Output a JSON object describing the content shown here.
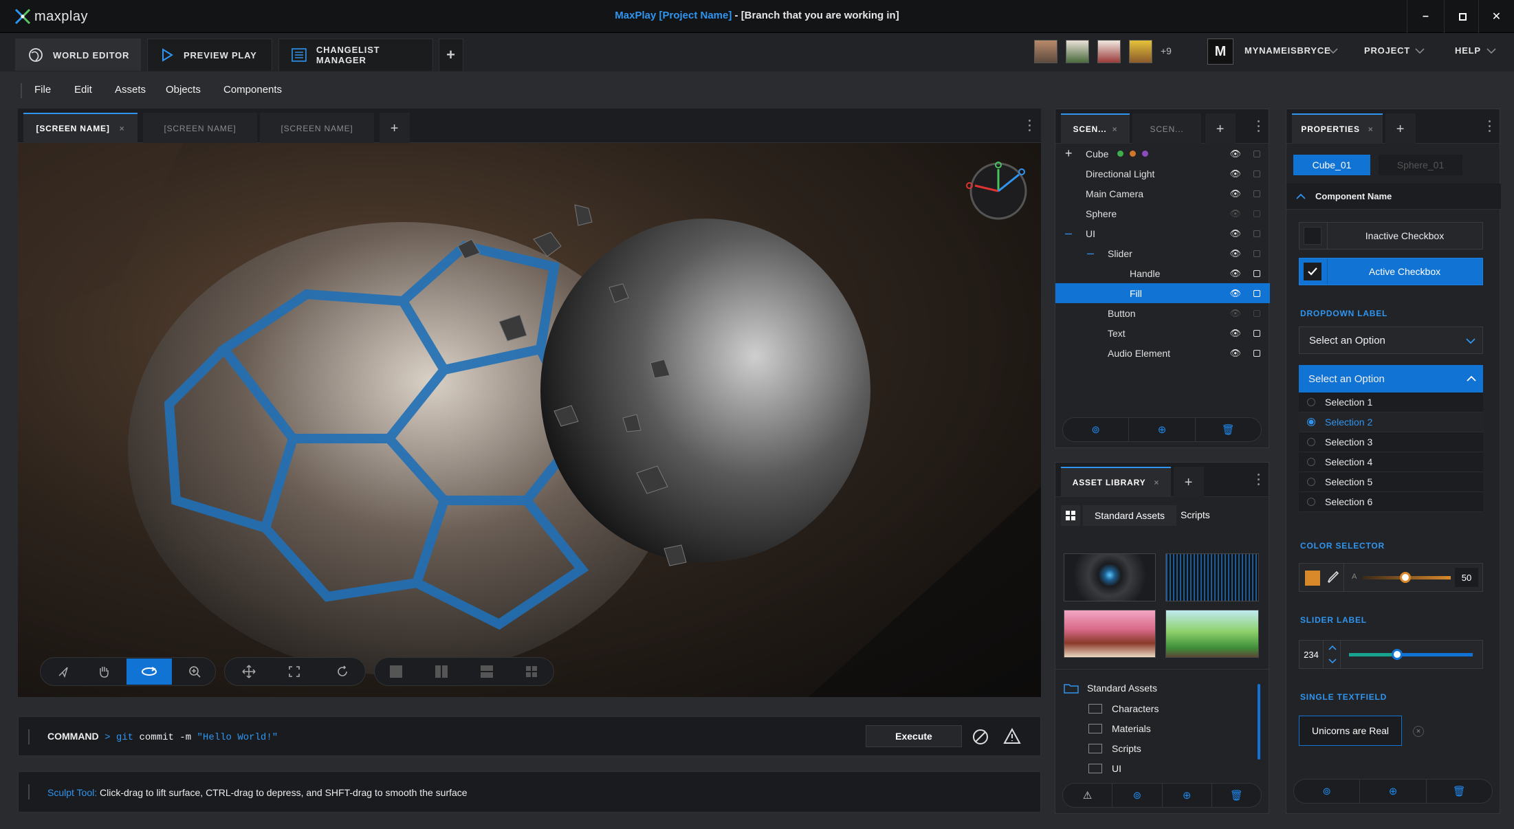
{
  "app": {
    "logo_text": "maxplay",
    "title_project": "MaxPlay [Project Name]",
    "title_rest": " - [Branch that you are working in]"
  },
  "window_controls": {
    "minimize": "–",
    "maximize": "□",
    "close": "✕"
  },
  "main_tabs": [
    {
      "label": "WORLD EDITOR",
      "icon": "world-icon",
      "active": true
    },
    {
      "label": "PREVIEW PLAY",
      "icon": "play-icon",
      "active": false
    },
    {
      "label": "CHANGELIST MANAGER",
      "icon": "list-icon",
      "active": false
    }
  ],
  "collaborators": {
    "extra_count": "+9"
  },
  "user": {
    "avatar_letter": "M",
    "name": "MYNAMEISBRYCE"
  },
  "top_menus": {
    "project": "PROJECT",
    "help": "HELP"
  },
  "menu": [
    "File",
    "Edit",
    "Assets",
    "Objects",
    "Components"
  ],
  "viewport_tabs": [
    "[SCREEN NAME]",
    "[SCREEN NAME]",
    "[SCREEN NAME]"
  ],
  "command": {
    "label": "COMMAND",
    "prompt": ">",
    "cmd_git": "git",
    "cmd_args": " commit -m ",
    "cmd_msg": "\"Hello World!\"",
    "execute": "Execute"
  },
  "status": {
    "tool": "Sculpt Tool:",
    "text": " Click-drag to lift surface, CTRL-drag to depress, and SHFT-drag to smooth the surface"
  },
  "scene": {
    "tabs": [
      "SCEN...",
      "SCEN..."
    ],
    "items": [
      {
        "label": "Cube",
        "prefix": "+",
        "dots": [
          "#3cae4b",
          "#d0782a",
          "#8e4bbf"
        ]
      },
      {
        "label": "Directional Light"
      },
      {
        "label": "Main Camera"
      },
      {
        "label": "Sphere"
      },
      {
        "label": "UI",
        "prefix": "–"
      },
      {
        "label": "Slider",
        "prefix": "–"
      },
      {
        "label": "Handle"
      },
      {
        "label": "Fill",
        "selected": true
      },
      {
        "label": "Button"
      },
      {
        "label": "Text"
      },
      {
        "label": "Audio Element"
      }
    ]
  },
  "assets": {
    "tab": "ASSET LIBRARY",
    "crumbs": [
      "Standard Assets",
      "Scripts"
    ],
    "tree_root": "Standard Assets",
    "folders": [
      "Characters",
      "Materials",
      "Scripts",
      "UI"
    ]
  },
  "properties": {
    "tab": "PROPERTIES",
    "objects": [
      "Cube_01",
      "Sphere_01"
    ],
    "component_name": "Component Name",
    "inactive_checkbox": "Inactive Checkbox",
    "active_checkbox": "Active Checkbox",
    "dropdown_label": "DROPDOWN LABEL",
    "dropdown_value": "Select an Option",
    "dropdown_open_value": "Select an Option",
    "options": [
      "Selection 1",
      "Selection 2",
      "Selection 3",
      "Selection 4",
      "Selection 5",
      "Selection 6"
    ],
    "selected_option": 1,
    "color_selector": "COLOR SELECTOR",
    "color_swatch": "#d9892a",
    "alpha_label": "A",
    "alpha_value": "50",
    "slider_label": "SLIDER LABEL",
    "slider_value": "234",
    "textfield_label": "SINGLE TEXTFIELD",
    "textfield_value": "Unicorns are Real"
  },
  "colors": {
    "accent": "#1173d4",
    "accent_text": "#2f95f0"
  }
}
